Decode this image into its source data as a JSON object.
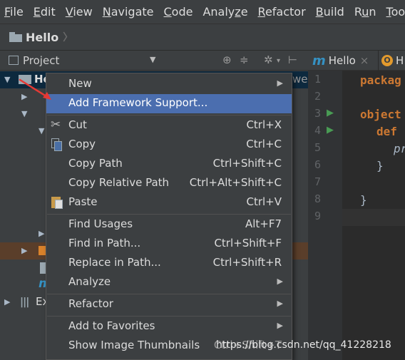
{
  "menubar": {
    "items": [
      {
        "pre": "",
        "u": "F",
        "post": "ile"
      },
      {
        "pre": "",
        "u": "E",
        "post": "dit"
      },
      {
        "pre": "",
        "u": "V",
        "post": "iew"
      },
      {
        "pre": "",
        "u": "N",
        "post": "avigate"
      },
      {
        "pre": "",
        "u": "C",
        "post": "ode"
      },
      {
        "pre": "Analy",
        "u": "z",
        "post": "e"
      },
      {
        "pre": "",
        "u": "R",
        "post": "efactor"
      },
      {
        "pre": "",
        "u": "B",
        "post": "uild"
      },
      {
        "pre": "R",
        "u": "u",
        "post": "n"
      },
      {
        "pre": "",
        "u": "T",
        "post": "ools"
      }
    ]
  },
  "navbar": {
    "breadcrumb": "Hello"
  },
  "project": {
    "title": "Project",
    "tree": {
      "root": "He",
      "root_suffix": "we",
      "ext_label": "Ex"
    }
  },
  "editor": {
    "tabs": [
      {
        "label": "Hello",
        "icon": "m",
        "close": "×"
      },
      {
        "label": "H",
        "icon": "O"
      }
    ],
    "line_numbers": [
      "1",
      "2",
      "3",
      "4",
      "5",
      "6",
      "7",
      "8",
      "9"
    ],
    "code": {
      "line1": "packag",
      "line3": "object",
      "line4": "def",
      "line5": "pr",
      "line6": "}",
      "line8": "}"
    }
  },
  "context_menu": {
    "items": [
      {
        "label": "New",
        "shortcut": "",
        "submenu": true
      },
      {
        "label": "Add Framework Support...",
        "shortcut": "",
        "submenu": false,
        "highlighted": true
      },
      {
        "label": "Cut",
        "shortcut": "Ctrl+X",
        "icon": "scissors-icon"
      },
      {
        "label": "Copy",
        "shortcut": "Ctrl+C",
        "icon": "copy-icon"
      },
      {
        "label": "Copy Path",
        "shortcut": "Ctrl+Shift+C"
      },
      {
        "label": "Copy Relative Path",
        "shortcut": "Ctrl+Alt+Shift+C"
      },
      {
        "label": "Paste",
        "shortcut": "Ctrl+V",
        "icon": "paste-icon"
      },
      {
        "label": "Find Usages",
        "shortcut": "Alt+F7"
      },
      {
        "label": "Find in Path...",
        "shortcut": "Ctrl+Shift+F"
      },
      {
        "label": "Replace in Path...",
        "shortcut": "Ctrl+Shift+R"
      },
      {
        "label": "Analyze",
        "shortcut": "",
        "submenu": true
      },
      {
        "label": "Refactor",
        "shortcut": "",
        "submenu": true
      },
      {
        "label": "Add to Favorites",
        "shortcut": "",
        "submenu": true
      },
      {
        "label": "Show Image Thumbnails",
        "shortcut": "Ctrl+Shift+T"
      }
    ],
    "colors": {
      "highlight": "#4b6eaf",
      "background": "#3c3f41"
    }
  },
  "watermark": "https://blog.csdn.net/qq_41228218",
  "arrow_color": "#e53935"
}
